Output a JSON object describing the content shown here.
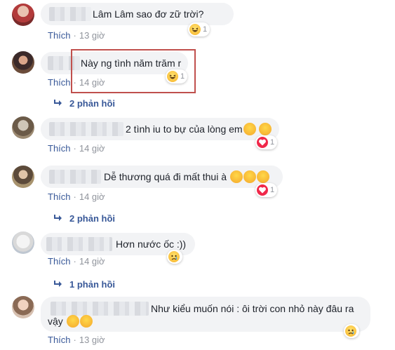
{
  "comments": [
    {
      "text": "Lâm Lâm sao đơ zữ trời?",
      "like": "Thích",
      "time": "13 giờ",
      "reaction": "haha",
      "reaction_count": "1"
    },
    {
      "text": "Này ng tình năm trăm r",
      "like": "Thích",
      "time": "14 giờ",
      "reaction": "haha",
      "reaction_count": "1",
      "replies": "2 phản hồi"
    },
    {
      "text": "2 tình iu to bự của lòng em",
      "like": "Thích",
      "time": "14 giờ",
      "reaction": "love",
      "reaction_count": "1"
    },
    {
      "text": "Dễ thương quá đi mất thui à",
      "like": "Thích",
      "time": "14 giờ",
      "reaction": "love",
      "reaction_count": "1",
      "replies": "2 phản hồi"
    },
    {
      "text": "Hơn nước ốc :))",
      "like": "Thích",
      "time": "14 giờ",
      "reaction": "sad",
      "replies": "1 phản hồi"
    },
    {
      "text_line1": "Như kiểu muốn nói : ôi trời con nhỏ này đâu ra",
      "text_line2": "vậy",
      "like": "Thích",
      "time": "13 giờ",
      "reaction": "sad"
    }
  ],
  "icons": {
    "like_color": "#385898",
    "meta_color": "#90949c",
    "bubble_color": "#f2f3f5",
    "highlight_color": "#c0504d"
  }
}
